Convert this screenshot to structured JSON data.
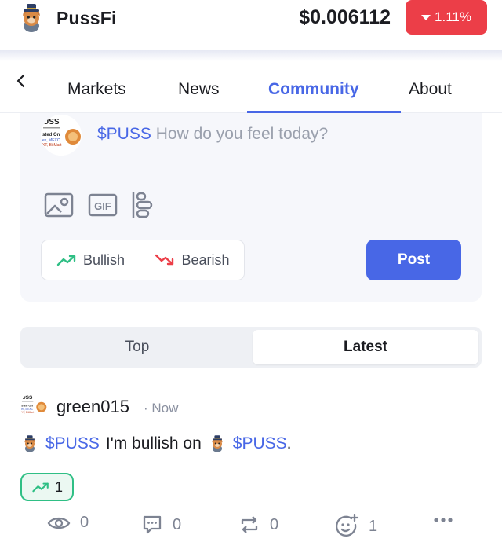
{
  "header": {
    "app_name": "PussFi",
    "price": "$0.006112",
    "change": "1.11%",
    "change_color": "#ec3e48"
  },
  "tabs": [
    {
      "label": "Markets"
    },
    {
      "label": "News"
    },
    {
      "label": "Community",
      "active": true
    },
    {
      "label": "About"
    }
  ],
  "composer": {
    "ticker": "$PUSS",
    "placeholder": "How do you feel today?",
    "tools": [
      "image-icon",
      "gif-icon",
      "poll-icon"
    ],
    "bullish_label": "Bullish",
    "bearish_label": "Bearish",
    "post_label": "Post"
  },
  "feed_tabs": {
    "top": "Top",
    "latest": "Latest",
    "selected": "Latest"
  },
  "post": {
    "username": "green015",
    "time": "· Now",
    "ticker1": "$PUSS",
    "text": "I'm bullish on",
    "ticker2": "$PUSS",
    "trailing": ".",
    "bullish_count": "1",
    "views": "0",
    "comments": "0",
    "reposts": "0",
    "reactions": "1"
  },
  "colors": {
    "accent": "#4867e6",
    "bullish": "#2fbf85",
    "bearish": "#ec3e48"
  }
}
